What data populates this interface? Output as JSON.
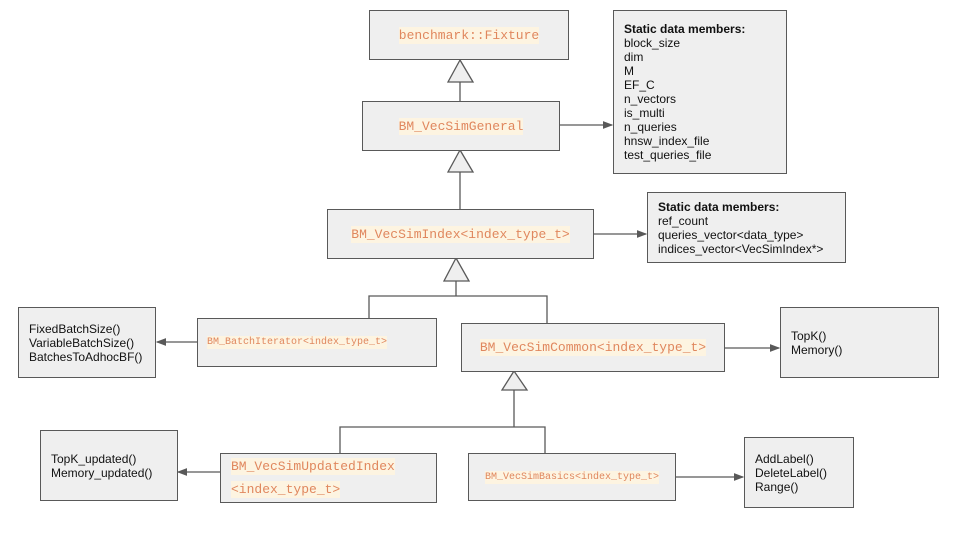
{
  "classes": {
    "fixture": "benchmark::Fixture",
    "general": "BM_VecSimGeneral",
    "index": "BM_VecSimIndex<index_type_t>",
    "batch_iterator": "BM_BatchIterator<index_type_t>",
    "common": "BM_VecSimCommon<index_type_t>",
    "updated_index_line1": "BM_VecSimUpdatedIndex",
    "updated_index_line2": "<index_type_t>",
    "basics": "BM_VecSimBasics<index_type_t>"
  },
  "notes": {
    "general_static": {
      "header": "Static data members:",
      "items": [
        "block_size",
        "dim",
        "M",
        "EF_C",
        "n_vectors",
        "is_multi",
        "n_queries",
        "hnsw_index_file",
        "test_queries_file"
      ]
    },
    "index_static": {
      "header": "Static data members:",
      "items": [
        "ref_count",
        "queries_vector<data_type>",
        "indices_vector<VecSimIndex*>"
      ]
    },
    "batch_methods": {
      "items": [
        "FixedBatchSize()",
        "VariableBatchSize()",
        "BatchesToAdhocBF()"
      ]
    },
    "common_methods": {
      "items": [
        "TopK()",
        "Memory()"
      ]
    },
    "updated_methods": {
      "items": [
        "TopK_updated()",
        "Memory_updated()"
      ]
    },
    "basics_methods": {
      "items": [
        "AddLabel()",
        "DeleteLabel()",
        "Range()"
      ]
    }
  },
  "colors": {
    "class_text": "#e0875e",
    "code_highlight": "#fdf4e1",
    "box_fill": "#efefef",
    "line": "#595959"
  }
}
